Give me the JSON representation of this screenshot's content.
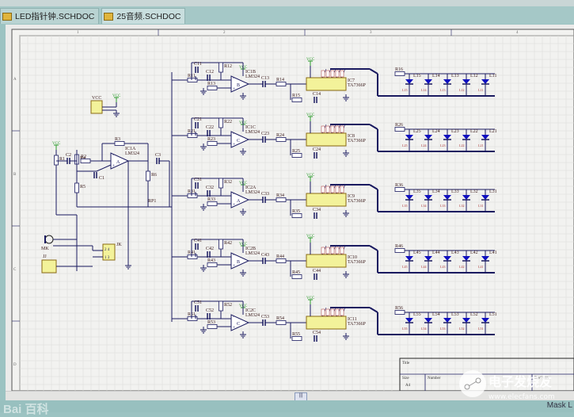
{
  "tabs": [
    {
      "label": "LED指针钟.SCHDOC",
      "active": false
    },
    {
      "label": "25音频.SCHDOC",
      "active": true
    }
  ],
  "ruler": {
    "columns": [
      "1",
      "2",
      "3",
      "4"
    ],
    "rows": [
      "A",
      "B",
      "C",
      "D"
    ]
  },
  "title_block": {
    "title_label": "Title",
    "size_label": "Size",
    "size_value": "A4",
    "number_label": "Number",
    "revision_label": "Revision"
  },
  "status": {
    "mask_label": "Mask L"
  },
  "watermark": {
    "text": "电子发烧友",
    "url": "www.elecfans.com",
    "baidu": "Bai百科"
  },
  "colors": {
    "part_fill": "#f3f29a",
    "part_border": "#8a6a14",
    "wire": "#1a1a60",
    "power": "#2a9a2a",
    "led": "#1010c0",
    "label": "#3a1a1a"
  },
  "input_stage": {
    "vcc_conn": "VCC",
    "vcc": "VCC",
    "r1": "R1",
    "r2": "R2",
    "r3": "R3",
    "r4": "R4",
    "r5": "R5",
    "r6": "R6",
    "c1": "C1",
    "c2": "C2",
    "c3": "C3",
    "opamp": "IC1A",
    "opamp_type": "LM324",
    "rp": "RP1",
    "mic": "MK",
    "jack": "JJ",
    "switch": "JK"
  },
  "channels": [
    {
      "r_in": "R11",
      "c_a": "C11",
      "c_b": "C12",
      "r_fb": "R12",
      "r_g": "R13",
      "opamp": "IC1B",
      "opamp_type": "LM324",
      "c_out": "C13",
      "r_s": "R14",
      "r_p": "R15",
      "c_p": "C14",
      "ic": "IC7",
      "ic_type": "TA7366P",
      "r_led": "R16",
      "leds": [
        "L15",
        "L14",
        "L13",
        "L12",
        "L11"
      ]
    },
    {
      "r_in": "R21",
      "c_a": "C21",
      "c_b": "C22",
      "r_fb": "R22",
      "r_g": "R23",
      "opamp": "IC1C",
      "opamp_type": "LM324",
      "c_out": "C23",
      "r_s": "R24",
      "r_p": "R25",
      "c_p": "C24",
      "ic": "IC8",
      "ic_type": "TA7366P",
      "r_led": "R26",
      "leds": [
        "L25",
        "L24",
        "L23",
        "L22",
        "L21"
      ]
    },
    {
      "r_in": "R31",
      "c_a": "C31",
      "c_b": "C32",
      "r_fb": "R32",
      "r_g": "R33",
      "opamp": "IC2A",
      "opamp_type": "LM324",
      "c_out": "C33",
      "r_s": "R34",
      "r_p": "R35",
      "c_p": "C34",
      "ic": "IC9",
      "ic_type": "TA7366P",
      "r_led": "R36",
      "leds": [
        "L35",
        "L34",
        "L33",
        "L32",
        "L31"
      ]
    },
    {
      "r_in": "R41",
      "c_a": "C41",
      "c_b": "C42",
      "r_fb": "R42",
      "r_g": "R43",
      "opamp": "IC2B",
      "opamp_type": "LM324",
      "c_out": "C43",
      "r_s": "R44",
      "r_p": "R45",
      "c_p": "C44",
      "ic": "IC10",
      "ic_type": "TA7366P",
      "r_led": "R46",
      "leds": [
        "L45",
        "L44",
        "L43",
        "L42",
        "L41"
      ]
    },
    {
      "r_in": "R51",
      "c_a": "C51",
      "c_b": "C52",
      "r_fb": "R52",
      "r_g": "R53",
      "opamp": "IC2C",
      "opamp_type": "LM324",
      "c_out": "C53",
      "r_s": "R54",
      "r_p": "R55",
      "c_p": "C54",
      "ic": "IC11",
      "ic_type": "TA7366P",
      "r_led": "R56",
      "leds": [
        "L55",
        "L54",
        "L53",
        "L52",
        "L51"
      ]
    }
  ]
}
